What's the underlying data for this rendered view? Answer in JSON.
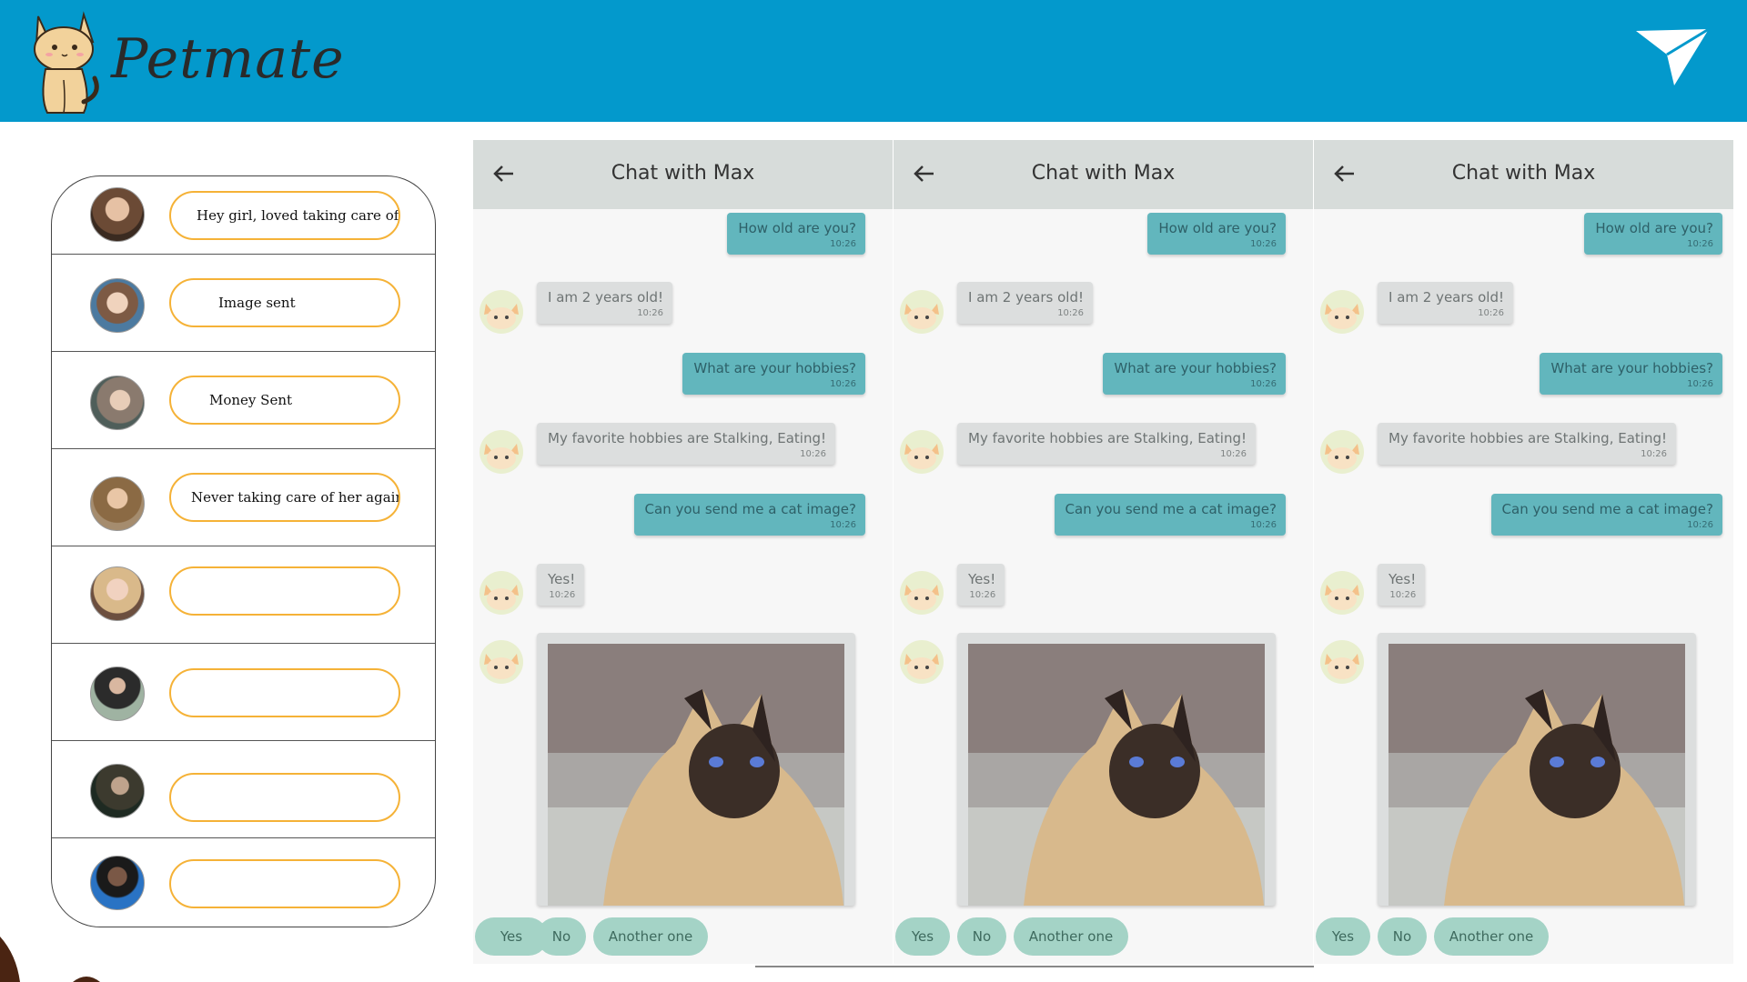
{
  "app": {
    "brand": "Petmate",
    "colors": {
      "header": "#0399cc",
      "pill_border": "#f5b237",
      "outgoing": "#62b6bd",
      "incoming": "#dcdede",
      "quick_reply": "#a4d3c6"
    },
    "send_icon": "paper-plane-icon"
  },
  "inbox": {
    "items": [
      {
        "preview": "Hey girl, loved taking care of . . ."
      },
      {
        "preview": "Image sent"
      },
      {
        "preview": "Money Sent"
      },
      {
        "preview": "Never taking care of her again . . ."
      },
      {
        "preview": ""
      },
      {
        "preview": ""
      },
      {
        "preview": ""
      },
      {
        "preview": ""
      }
    ]
  },
  "chat": {
    "title": "Chat with Max",
    "back_icon": "arrow-left-icon",
    "messages": [
      {
        "dir": "out",
        "text": "How old are you?",
        "time": "10:26"
      },
      {
        "dir": "in",
        "text": "I am 2 years old!",
        "time": "10:26"
      },
      {
        "dir": "out",
        "text": "What are your hobbies?",
        "time": "10:26"
      },
      {
        "dir": "in",
        "text": "My favorite hobbies are Stalking, Eating!",
        "time": "10:26"
      },
      {
        "dir": "out",
        "text": "Can you send me a cat image?",
        "time": "10:26"
      },
      {
        "dir": "in",
        "text": "Yes!",
        "time": "10:26"
      }
    ],
    "quick_replies": [
      "Yes",
      "No",
      "Another one"
    ]
  }
}
